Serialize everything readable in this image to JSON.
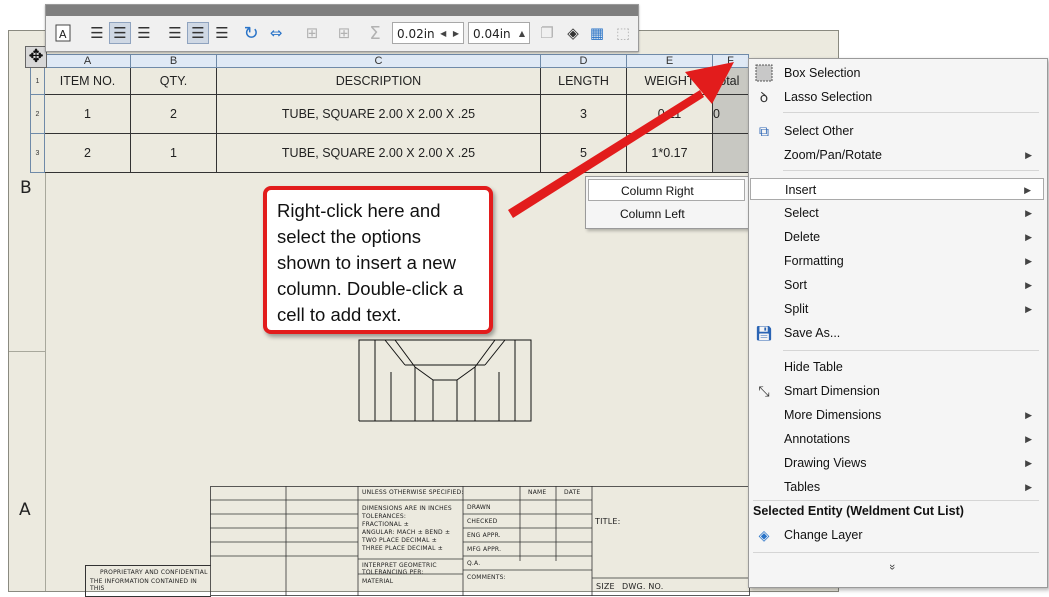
{
  "toolbar": {
    "offset_1": "0.02in",
    "offset_2": "0.04in"
  },
  "zones": {
    "b": "B",
    "a": "A"
  },
  "table": {
    "col_letters": [
      "A",
      "B",
      "C",
      "D",
      "E",
      "F"
    ],
    "headers": [
      "ITEM NO.",
      "QTY.",
      "DESCRIPTION",
      "LENGTH",
      "WEIGHT",
      "Total"
    ],
    "row_numbers": [
      "1",
      "2",
      "3"
    ],
    "rows": [
      [
        "1",
        "2",
        "TUBE, SQUARE 2.00 X 2.00 X .25",
        "3",
        "0.11",
        "0"
      ],
      [
        "2",
        "1",
        "TUBE, SQUARE 2.00 X 2.00 X .25",
        "5",
        "1*0.17",
        ""
      ]
    ]
  },
  "title_block": {
    "unless": "UNLESS OTHERWISE SPECIFIED:",
    "name": "NAME",
    "date": "DATE",
    "dims": "DIMENSIONS ARE IN INCHES",
    "tolerances": "TOLERANCES:",
    "fractional": "FRACTIONAL ±",
    "angular": "ANGULAR: MACH ±   BEND ±",
    "two_place": "TWO PLACE DECIMAL  ±",
    "three_place": "THREE PLACE DECIMAL  ±",
    "drawn": "DRAWN",
    "checked": "CHECKED",
    "eng": "ENG APPR.",
    "mfg": "MFG APPR.",
    "qa": "Q.A.",
    "comments": "COMMENTS:",
    "title": "TITLE:",
    "interpret": "INTERPRET GEOMETRIC",
    "tolerancing": "TOLERANCING PER:",
    "material": "MATERIAL",
    "proprietary": "PROPRIETARY AND CONFIDENTIAL",
    "info": "THE INFORMATION CONTAINED IN THIS",
    "size": "SIZE",
    "dwg": "DWG. NO."
  },
  "callout": {
    "text": "Right-click here and select the options shown to insert a new column. Double-click a cell to add text."
  },
  "submenu": {
    "items": [
      "Column Right",
      "Column Left"
    ]
  },
  "context_menu": {
    "items": [
      "Box Selection",
      "Lasso Selection",
      "Select Other",
      "Zoom/Pan/Rotate",
      "Insert",
      "Select",
      "Delete",
      "Formatting",
      "Sort",
      "Split",
      "Save As...",
      "Hide Table",
      "Smart Dimension",
      "More Dimensions",
      "Annotations",
      "Drawing Views",
      "Tables"
    ],
    "section_title": "Selected Entity (Weldment Cut List)",
    "change_layer": "Change Layer",
    "more": "»"
  },
  "colors": {
    "callout_border": "#e21c1c",
    "arrow": "#e21c1c",
    "header_blue": "#dfe9f5"
  }
}
